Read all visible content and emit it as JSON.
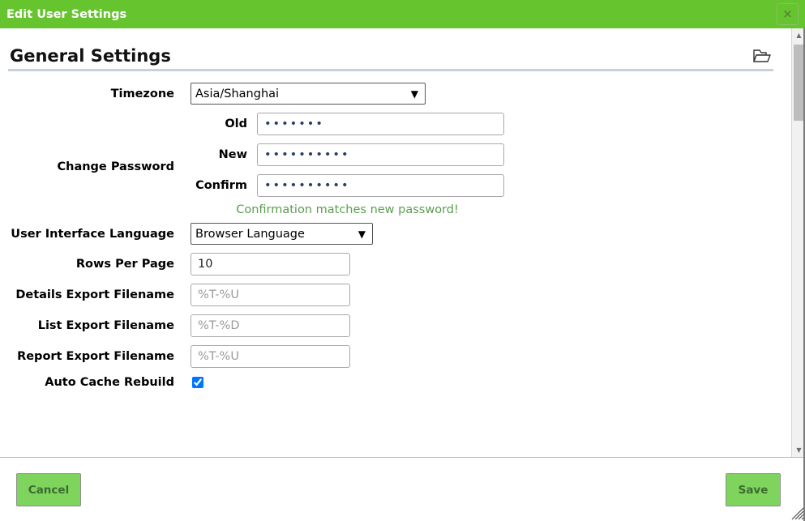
{
  "window": {
    "title": "Edit User Settings",
    "close_label": "×",
    "close_icon": "close-icon",
    "accent_green": "#66c42e",
    "button_green": "#7ed45c"
  },
  "section": {
    "title": "General Settings",
    "folder_icon": "folder-open-icon"
  },
  "form": {
    "timezone": {
      "label": "Timezone",
      "value": "Asia/Shanghai",
      "options": [
        "Asia/Shanghai"
      ],
      "arrow_icon": "chevron-down-icon"
    },
    "change_password": {
      "label": "Change Password",
      "old": {
        "label": "Old",
        "value": "•••••••"
      },
      "new": {
        "label": "New",
        "value": "••••••••••"
      },
      "confirm": {
        "label": "Confirm",
        "value": "••••••••••"
      },
      "message": "Confirmation matches new password!",
      "message_color": "#5a9e4f"
    },
    "ui_language": {
      "label": "User Interface Language",
      "value": "Browser Language",
      "options": [
        "Browser Language"
      ],
      "arrow_icon": "chevron-down-icon"
    },
    "rows_per_page": {
      "label": "Rows Per Page",
      "value": "10",
      "placeholder": ""
    },
    "details_export_filename": {
      "label": "Details Export Filename",
      "value": "",
      "placeholder": "%T-%U"
    },
    "list_export_filename": {
      "label": "List Export Filename",
      "value": "",
      "placeholder": "%T-%D"
    },
    "report_export_filename": {
      "label": "Report Export Filename",
      "value": "",
      "placeholder": "%T-%U"
    },
    "auto_cache_rebuild": {
      "label": "Auto Cache Rebuild",
      "checked": true
    }
  },
  "footer": {
    "cancel_label": "Cancel",
    "save_label": "Save"
  },
  "scrollbar": {
    "up_arrow_icon": "triangle-up-icon",
    "down_arrow_icon": "triangle-down-icon",
    "up_glyph": "▲",
    "down_glyph": "▼"
  }
}
